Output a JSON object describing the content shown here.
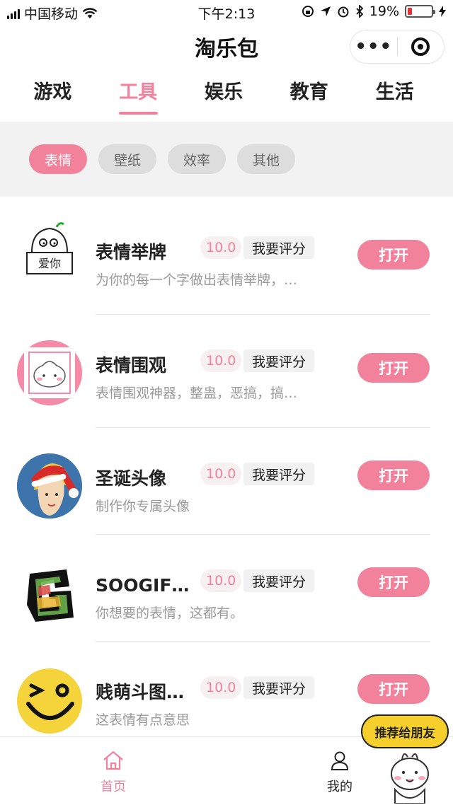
{
  "status_bar": {
    "carrier": "中国移动",
    "time": "下午2:13",
    "battery_text": "19%",
    "battery_level": 0.19,
    "battery_color": "#e33333"
  },
  "nav": {
    "title": "淘乐包",
    "more_icon": "more-icon",
    "target_icon": "close-miniprogram-icon"
  },
  "category_tabs": [
    {
      "label": "游戏",
      "active": false
    },
    {
      "label": "工具",
      "active": true
    },
    {
      "label": "娱乐",
      "active": false
    },
    {
      "label": "教育",
      "active": false
    },
    {
      "label": "生活",
      "active": false
    }
  ],
  "filters": [
    {
      "label": "表情",
      "active": true
    },
    {
      "label": "壁纸",
      "active": false
    },
    {
      "label": "效率",
      "active": false
    },
    {
      "label": "其他",
      "active": false
    }
  ],
  "rate_label": "我要评分",
  "open_label": "打开",
  "apps": [
    {
      "name": "表情举牌",
      "score": "10.0",
      "desc": "为你的每一个字做出表情举牌，以...",
      "icon": "sign-holding-sticker-icon",
      "sign_text": "爱你"
    },
    {
      "name": "表情围观",
      "score": "10.0",
      "desc": "表情围观神器，整蛊，恶搞，搞笑...",
      "icon": "crowd-watching-sticker-icon"
    },
    {
      "name": "圣诞头像",
      "score": "10.0",
      "desc": "制作你专属头像",
      "icon": "christmas-avatar-icon"
    },
    {
      "name": "SOOGIF动图",
      "score": "10.0",
      "desc": "你想要的表情，这都有。",
      "icon": "soogif-logo-icon"
    },
    {
      "name": "贱萌斗图神器",
      "score": "10.0",
      "desc": "这表情有点意思",
      "icon": "winking-smiley-icon"
    }
  ],
  "tab_bar": {
    "home_label": "首页",
    "home_icon": "home-icon",
    "mine_label": "我的",
    "mine_icon": "user-icon"
  },
  "recommend": {
    "label": "推荐给朋友",
    "icon": "mascot-sticker-icon"
  },
  "accent_color": "#f2829c"
}
